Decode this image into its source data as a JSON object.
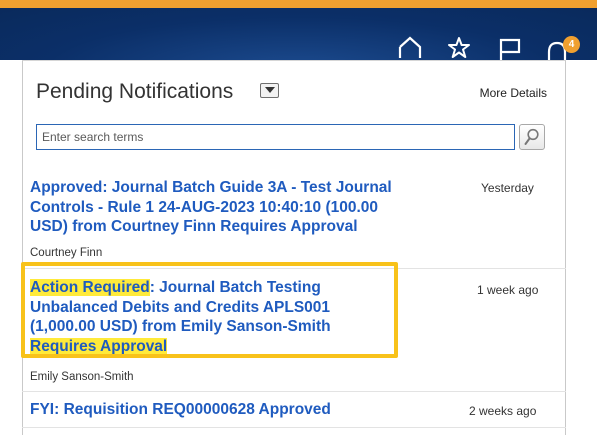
{
  "header": {
    "notification_count": "4",
    "icons": [
      "home-icon",
      "favorites-star-icon",
      "watchlist-flag-icon",
      "notifications-bell-icon"
    ]
  },
  "panel": {
    "title": "Pending Notifications",
    "more_details": "More Details",
    "search_placeholder": "Enter search terms"
  },
  "notifications": [
    {
      "title": "Approved: Journal Batch Guide 3A - Test Journal Controls - Rule 1 24-AUG-2023 10:40:10 (100.00 USD) from Courtney Finn Requires Approval",
      "time": "Yesterday",
      "from": "Courtney Finn"
    },
    {
      "title_highlight": "Action Required",
      "title_rest": ": Journal Batch Testing Unbalanced Debits and Credits APLS001 (1,000.00 USD) from Emily Sanson-Smith ",
      "title_highlight_end": "Requires Approval",
      "time": "1 week ago",
      "from": "Emily Sanson-Smith"
    },
    {
      "title": "FYI: Requisition REQ00000628 Approved",
      "time": "2 weeks ago"
    }
  ],
  "colors": {
    "accent_orange": "#f0a030",
    "header_navy": "#0b2f68",
    "link_blue": "#1f5bbf",
    "highlight_yellow": "#ffea3a",
    "callout_border": "#f8c21a"
  }
}
